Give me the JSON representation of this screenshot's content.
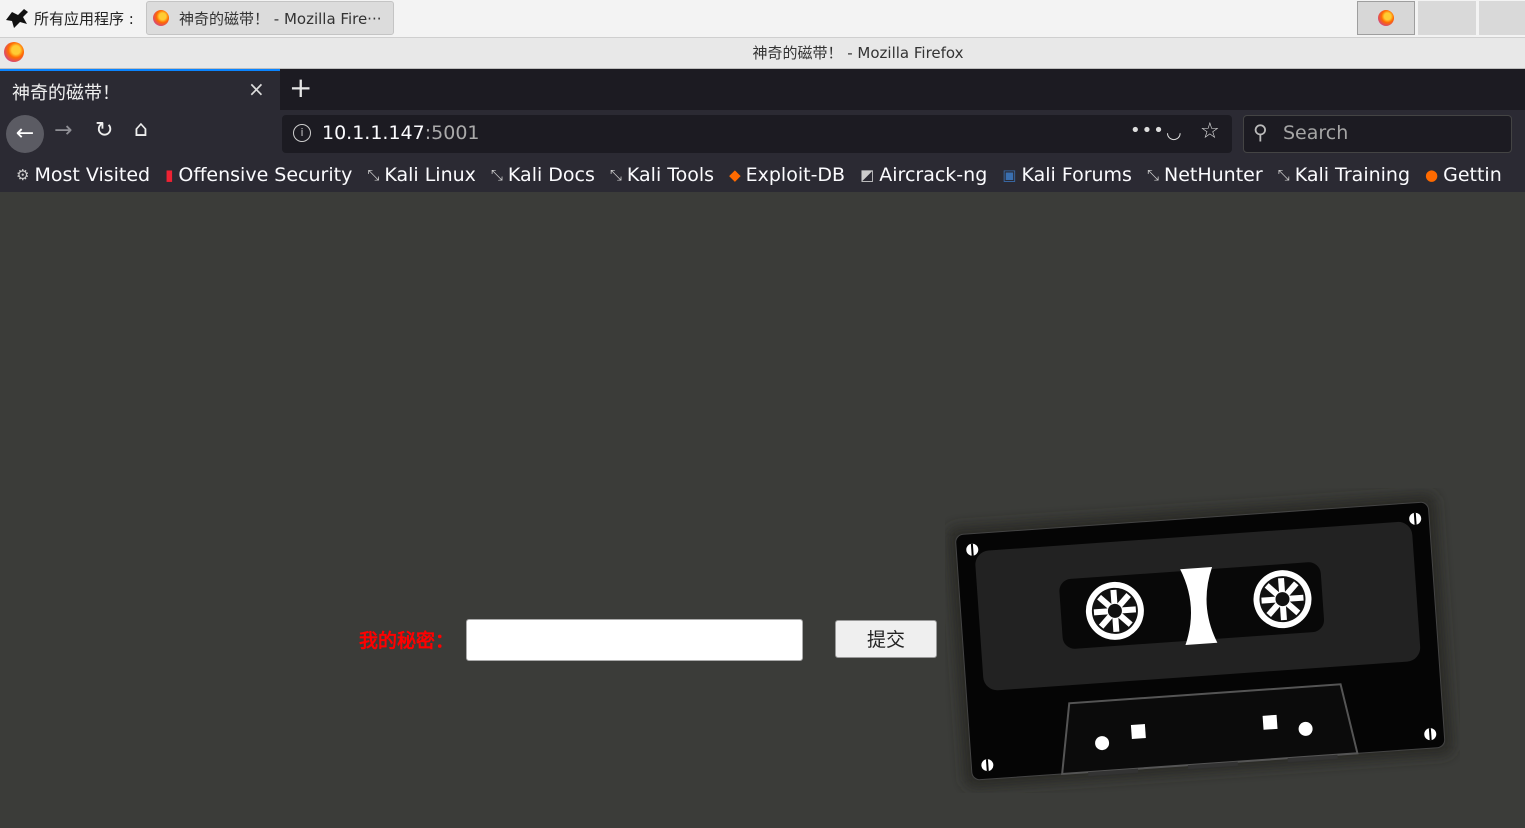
{
  "taskbar": {
    "apps_menu_label": "所有应用程序 :",
    "task_title": "神奇的磁带！ - Mozilla Fire···"
  },
  "window": {
    "title": "神奇的磁带！ - Mozilla Firefox"
  },
  "tabs": [
    {
      "label": "神奇的磁带！",
      "close": "×"
    }
  ],
  "newtab_label": "+",
  "nav": {
    "back": "←",
    "forward": "→",
    "reload": "↻",
    "home": "⌂"
  },
  "url": {
    "host": "10.1.1.147",
    "port": ":5001",
    "info_icon": "i",
    "more": "•••",
    "pocket": "◡",
    "star": "☆"
  },
  "search": {
    "placeholder": "Search",
    "icon": "⚲"
  },
  "bookmarks": [
    {
      "label": "Most Visited",
      "icon": "gear-icon",
      "glyph": "⚙"
    },
    {
      "label": "Offensive Security",
      "icon": "offsec-icon",
      "glyph": "▮"
    },
    {
      "label": "Kali Linux",
      "icon": "kali-icon",
      "glyph": "⤡"
    },
    {
      "label": "Kali Docs",
      "icon": "kali-icon",
      "glyph": "⤡"
    },
    {
      "label": "Kali Tools",
      "icon": "kali-icon",
      "glyph": "⤡"
    },
    {
      "label": "Exploit-DB",
      "icon": "exploitdb-icon",
      "glyph": "◆"
    },
    {
      "label": "Aircrack-ng",
      "icon": "aircrack-icon",
      "glyph": "◩"
    },
    {
      "label": "Kali Forums",
      "icon": "forums-icon",
      "glyph": "▣"
    },
    {
      "label": "NetHunter",
      "icon": "kali-icon",
      "glyph": "⤡"
    },
    {
      "label": "Kali Training",
      "icon": "kali-icon",
      "glyph": "⤡"
    },
    {
      "label": "Gettin",
      "icon": "firefox-icon",
      "glyph": "●"
    }
  ],
  "form": {
    "label": "我的秘密：",
    "input_value": "",
    "submit": "提交"
  }
}
